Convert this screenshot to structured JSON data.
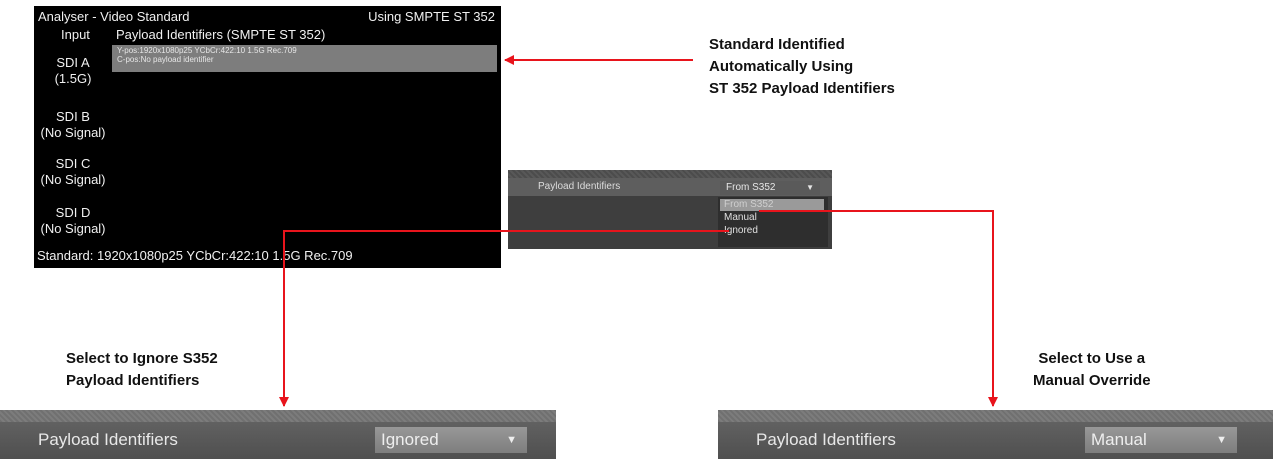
{
  "analyser": {
    "title": "Analyser - Video Standard",
    "mode": "Using SMPTE ST 352",
    "input_header": "Input",
    "payload_header": "Payload Identifiers (SMPTE ST 352)",
    "payload_lines": [
      "Y-pos:1920x1080p25 YCbCr:422:10 1.5G Rec.709",
      "C-pos:No payload identifier"
    ],
    "inputs": [
      {
        "name": "SDI A",
        "status": "(1.5G)"
      },
      {
        "name": "SDI B",
        "status": "(No Signal)"
      },
      {
        "name": "SDI C",
        "status": "(No Signal)"
      },
      {
        "name": "SDI D",
        "status": "(No Signal)"
      }
    ],
    "standard": "Standard: 1920x1080p25 YCbCr:422:10 1.5G Rec.709"
  },
  "small_panel": {
    "label": "Payload Identifiers",
    "selected": "From S352",
    "options": [
      "From S352",
      "Manual",
      "Ignored"
    ],
    "highlighted_option": "From S352"
  },
  "callouts": {
    "standard_identified": [
      "Standard Identified",
      "Automatically Using",
      "ST 352 Payload Identifiers"
    ],
    "ignore": [
      "Select to Ignore S352",
      "Payload Identifiers"
    ],
    "manual": [
      "Select to Use a",
      "Manual Override"
    ]
  },
  "bar_ignored": {
    "label": "Payload Identifiers",
    "value": "Ignored"
  },
  "bar_manual": {
    "label": "Payload Identifiers",
    "value": "Manual"
  },
  "icons": {
    "dropdown": "chevron-down-icon"
  },
  "colors": {
    "arrow": "#e8141c",
    "panel_bg": "#000000",
    "bar_bg": "#5a5a5a"
  }
}
